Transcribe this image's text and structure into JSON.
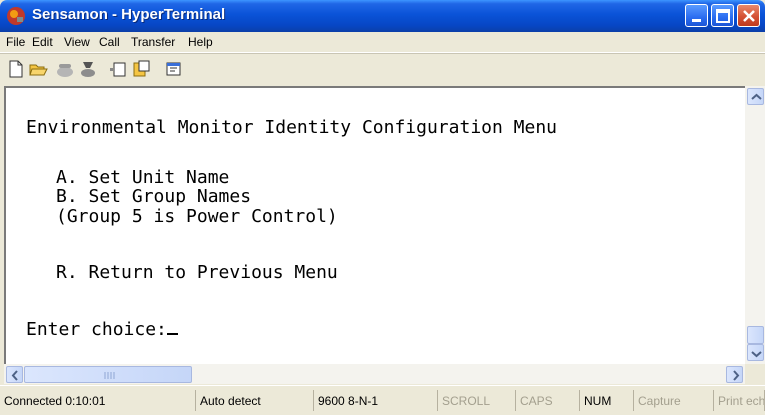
{
  "window": {
    "title": "Sensamon - HyperTerminal"
  },
  "menu": [
    "File",
    "Edit",
    "View",
    "Call",
    "Transfer",
    "Help"
  ],
  "toolbar": {
    "icons": [
      "new-document-icon",
      "open-folder-icon",
      "phone-icon",
      "disconnect-icon",
      "send-icon",
      "receive-icon",
      "properties-icon"
    ]
  },
  "terminal": {
    "lines": [
      "Environmental Monitor Identity Configuration Menu",
      "A. Set Unit Name",
      "B. Set Group Names",
      "(Group 5 is Power Control)",
      "R. Return to Previous Menu",
      "Enter choice:"
    ]
  },
  "status": {
    "connected": "Connected 0:10:01",
    "detect": "Auto detect",
    "settings": "9600 8-N-1",
    "scroll": "SCROLL",
    "caps": "CAPS",
    "num": "NUM",
    "capture": "Capture",
    "print": "Print echo"
  },
  "colors": {
    "titlebar": "#0a53d8",
    "close": "#d45235",
    "terminal_bg": "#ffffff",
    "chrome": "#ece9d8"
  }
}
